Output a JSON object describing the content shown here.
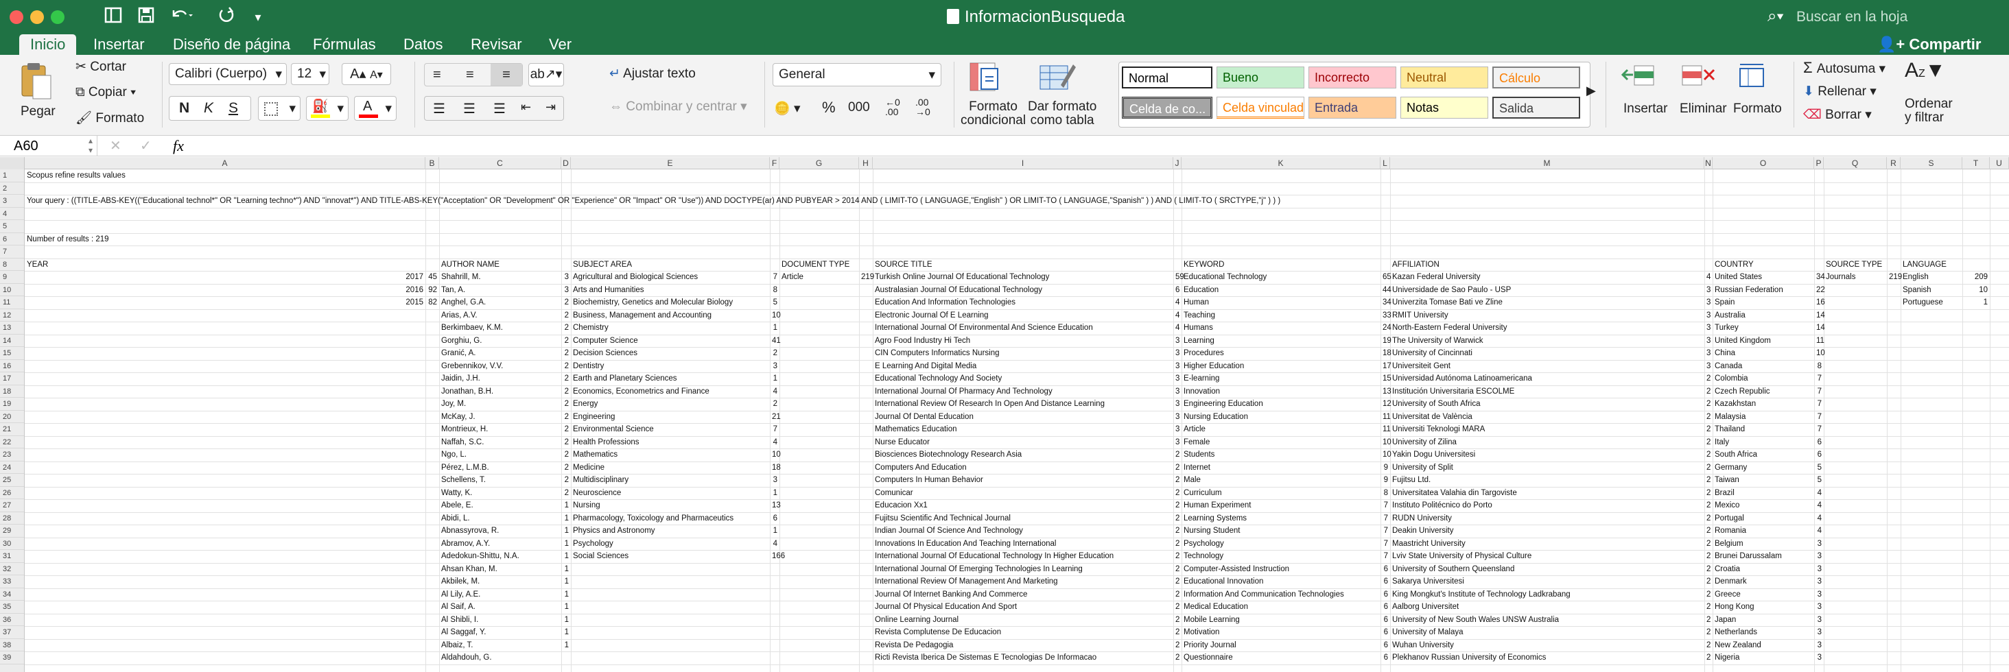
{
  "window": {
    "title": "InformacionBusqueda",
    "search_placeholder": "Buscar en la hoja",
    "share_label": "Compartir",
    "colors": {
      "brand": "#1f7244",
      "ribbon": "#f3f3f3"
    }
  },
  "tabs": [
    "Inicio",
    "Insertar",
    "Diseño de página",
    "Fórmulas",
    "Datos",
    "Revisar",
    "Ver"
  ],
  "active_tab": "Inicio",
  "ribbon": {
    "paste": "Pegar",
    "cut": "Cortar",
    "copy": "Copiar",
    "format_painter": "Formato",
    "font_name": "Calibri (Cuerpo)",
    "font_size": "12",
    "bold": "N",
    "italic": "K",
    "underline": "S",
    "wrap_text": "Ajustar texto",
    "merge_center": "Combinar y centrar",
    "number_format": "General",
    "percent": "%",
    "thousands": "000",
    "conditional_format": [
      "Formato",
      "condicional"
    ],
    "format_as_table": [
      "Dar formato",
      "como tabla"
    ],
    "styles": [
      {
        "label": "Normal",
        "bg": "#ffffff",
        "color": "#000000"
      },
      {
        "label": "Bueno",
        "bg": "#c6efce",
        "color": "#006100"
      },
      {
        "label": "Incorrecto",
        "bg": "#ffc7ce",
        "color": "#9c0006"
      },
      {
        "label": "Neutral",
        "bg": "#ffeb9c",
        "color": "#9c5700"
      },
      {
        "label": "Cálculo",
        "bg": "#f2f2f2",
        "color": "#fa7d00"
      },
      {
        "label": "Celda de co...",
        "bg": "#a5a5a5",
        "color": "#ffffff"
      },
      {
        "label": "Celda vinculada",
        "bg": "#ffffff",
        "color": "#fa7d00"
      },
      {
        "label": "Entrada",
        "bg": "#ffcc99",
        "color": "#3f3f76"
      },
      {
        "label": "Notas",
        "bg": "#ffffcc",
        "color": "#000000"
      },
      {
        "label": "Salida",
        "bg": "#f2f2f2",
        "color": "#3f3f3f"
      }
    ],
    "insert": "Insertar",
    "delete": "Eliminar",
    "format": "Formato",
    "autosum": "Autosuma",
    "fill": "Rellenar",
    "clear": "Borrar",
    "sort_filter": [
      "Ordenar",
      "y filtrar"
    ]
  },
  "formula_bar": {
    "name_box": "A60",
    "fx": "fx",
    "content": ""
  },
  "sheet": {
    "columns": [
      "A",
      "B",
      "C",
      "D",
      "E",
      "F",
      "G",
      "H",
      "I",
      "J",
      "K",
      "L",
      "M",
      "N",
      "O",
      "P",
      "Q",
      "R",
      "S",
      "T",
      "U"
    ],
    "row_numbers": [
      "1",
      "2",
      "3",
      "4",
      "5",
      "6",
      "7",
      "8",
      "9",
      "10",
      "11",
      "12",
      "13",
      "14",
      "15",
      "16",
      "17",
      "18",
      "19",
      "20",
      "21",
      "22",
      "23",
      "24",
      "25",
      "26",
      "27",
      "28",
      "29",
      "30",
      "31",
      "32",
      "33",
      "34",
      "35",
      "36",
      "37",
      "38",
      "39"
    ],
    "a1": "Scopus refine results values",
    "a3": "Your query : ((TITLE-ABS-KEY((\"Educational technol*\" OR \"Learning techno*\") AND \"innovat*\") AND TITLE-ABS-KEY(\"Acceptation\" OR \"Development\" OR \"Experience\" OR \"Impact\" OR \"Use\")) AND DOCTYPE(ar) AND PUBYEAR > 2014 AND ( LIMIT-TO ( LANGUAGE,\"English\" ) OR LIMIT-TO ( LANGUAGE,\"Spanish\" ) )  AND ( LIMIT-TO ( SRCTYPE,\"j\" ) ) )",
    "a6": "Number of results : 219",
    "headers": {
      "year": "YEAR",
      "author": "AUTHOR NAME",
      "subject": "SUBJECT AREA",
      "doctype": "DOCUMENT TYPE",
      "source": "SOURCE TITLE",
      "keyword": "KEYWORD",
      "affiliation": "AFFILIATION",
      "country": "COUNTRY",
      "srctype": "SOURCE TYPE",
      "language": "LANGUAGE"
    },
    "years": [
      [
        "2017",
        "45"
      ],
      [
        "2016",
        "92"
      ],
      [
        "2015",
        "82"
      ]
    ],
    "authors": [
      [
        "Shahrill, M.",
        "3"
      ],
      [
        "Tan, A.",
        "3"
      ],
      [
        "Anghel, G.A.",
        "2"
      ],
      [
        "Arias, A.V.",
        "2"
      ],
      [
        "Berkimbaev, K.M.",
        "2"
      ],
      [
        "Gorghiu, G.",
        "2"
      ],
      [
        "Granić, A.",
        "2"
      ],
      [
        "Grebennikov, V.V.",
        "2"
      ],
      [
        "Jaidin, J.H.",
        "2"
      ],
      [
        "Jonathan, B.H.",
        "2"
      ],
      [
        "Joy, M.",
        "2"
      ],
      [
        "McKay, J.",
        "2"
      ],
      [
        "Montrieux, H.",
        "2"
      ],
      [
        "Naffah, S.C.",
        "2"
      ],
      [
        "Ngo, L.",
        "2"
      ],
      [
        "Pérez, L.M.B.",
        "2"
      ],
      [
        "Schellens, T.",
        "2"
      ],
      [
        "Watty, K.",
        "2"
      ],
      [
        "Abele, E.",
        "1"
      ],
      [
        "Abidi, L.",
        "1"
      ],
      [
        "Abnassyrova, R.",
        "1"
      ],
      [
        "Abramov, A.Y.",
        "1"
      ],
      [
        "Adedokun-Shittu, N.A.",
        "1"
      ],
      [
        "Ahsan Khan, M.",
        "1"
      ],
      [
        "Akbilek, M.",
        "1"
      ],
      [
        "Al Lily, A.E.",
        "1"
      ],
      [
        "Al Saif, A.",
        "1"
      ],
      [
        "Al Shibli, I.",
        "1"
      ],
      [
        "Al Saggaf, Y.",
        "1"
      ],
      [
        "Albaiz, T.",
        "1"
      ],
      [
        "Aldahdouh, G.",
        ""
      ]
    ],
    "subjects": [
      [
        "Agricultural and Biological Sciences",
        "7"
      ],
      [
        "Arts and Humanities",
        "8"
      ],
      [
        "Biochemistry, Genetics and Molecular Biology",
        "5"
      ],
      [
        "Business, Management and Accounting",
        "10"
      ],
      [
        "Chemistry",
        "1"
      ],
      [
        "Computer Science",
        "41"
      ],
      [
        "Decision Sciences",
        "2"
      ],
      [
        "Dentistry",
        "3"
      ],
      [
        "Earth and Planetary Sciences",
        "1"
      ],
      [
        "Economics, Econometrics and Finance",
        "4"
      ],
      [
        "Energy",
        "2"
      ],
      [
        "Engineering",
        "21"
      ],
      [
        "Environmental Science",
        "7"
      ],
      [
        "Health Professions",
        "4"
      ],
      [
        "Mathematics",
        "10"
      ],
      [
        "Medicine",
        "18"
      ],
      [
        "Multidisciplinary",
        "3"
      ],
      [
        "Neuroscience",
        "1"
      ],
      [
        "Nursing",
        "13"
      ],
      [
        "Pharmacology, Toxicology and Pharmaceutics",
        "6"
      ],
      [
        "Physics and Astronomy",
        "1"
      ],
      [
        "Psychology",
        "4"
      ],
      [
        "Social Sciences",
        "166"
      ]
    ],
    "doctypes": [
      [
        "Article",
        "219"
      ]
    ],
    "sources": [
      [
        "Turkish Online Journal Of Educational Technology",
        "59"
      ],
      [
        "Australasian Journal Of Educational Technology",
        "6"
      ],
      [
        "Education And Information Technologies",
        "4"
      ],
      [
        "Electronic Journal Of E Learning",
        "4"
      ],
      [
        "International Journal Of Environmental And Science Education",
        "4"
      ],
      [
        "Agro Food Industry Hi Tech",
        "3"
      ],
      [
        "CIN Computers Informatics Nursing",
        "3"
      ],
      [
        "E Learning And Digital Media",
        "3"
      ],
      [
        "Educational Technology And Society",
        "3"
      ],
      [
        "International Journal Of Pharmacy And Technology",
        "3"
      ],
      [
        "International Review Of Research In Open And Distance Learning",
        "3"
      ],
      [
        "Journal Of Dental Education",
        "3"
      ],
      [
        "Mathematics Education",
        "3"
      ],
      [
        "Nurse Educator",
        "3"
      ],
      [
        "Biosciences Biotechnology Research Asia",
        "2"
      ],
      [
        "Computers And Education",
        "2"
      ],
      [
        "Computers In Human Behavior",
        "2"
      ],
      [
        "Comunicar",
        "2"
      ],
      [
        "Educacion Xx1",
        "2"
      ],
      [
        "Fujitsu Scientific And Technical Journal",
        "2"
      ],
      [
        "Indian Journal Of Science And Technology",
        "2"
      ],
      [
        "Innovations In Education And Teaching International",
        "2"
      ],
      [
        "International Journal Of Educational Technology In Higher Education",
        "2"
      ],
      [
        "International Journal Of Emerging Technologies In Learning",
        "2"
      ],
      [
        "International Review Of Management And Marketing",
        "2"
      ],
      [
        "Journal Of Internet Banking And Commerce",
        "2"
      ],
      [
        "Journal Of Physical Education And Sport",
        "2"
      ],
      [
        "Online Learning Journal",
        "2"
      ],
      [
        "Revista Complutense De Educacion",
        "2"
      ],
      [
        "Revista De Pedagogia",
        "2"
      ],
      [
        "Ricti Revista Iberica De Sistemas E Tecnologias De Informacao",
        "2"
      ]
    ],
    "keywords": [
      [
        "Educational Technology",
        "65"
      ],
      [
        "Education",
        "44"
      ],
      [
        "Human",
        "34"
      ],
      [
        "Teaching",
        "33"
      ],
      [
        "Humans",
        "24"
      ],
      [
        "Learning",
        "19"
      ],
      [
        "Procedures",
        "18"
      ],
      [
        "Higher Education",
        "17"
      ],
      [
        "E-learning",
        "15"
      ],
      [
        "Innovation",
        "13"
      ],
      [
        "Engineering Education",
        "12"
      ],
      [
        "Nursing Education",
        "11"
      ],
      [
        "Article",
        "11"
      ],
      [
        "Female",
        "10"
      ],
      [
        "Students",
        "10"
      ],
      [
        "Internet",
        "9"
      ],
      [
        "Male",
        "9"
      ],
      [
        "Curriculum",
        "8"
      ],
      [
        "Human Experiment",
        "7"
      ],
      [
        "Learning Systems",
        "7"
      ],
      [
        "Nursing Student",
        "7"
      ],
      [
        "Psychology",
        "7"
      ],
      [
        "Technology",
        "7"
      ],
      [
        "Computer-Assisted Instruction",
        "6"
      ],
      [
        "Educational Innovation",
        "6"
      ],
      [
        "Information And Communication Technologies",
        "6"
      ],
      [
        "Medical Education",
        "6"
      ],
      [
        "Mobile Learning",
        "6"
      ],
      [
        "Motivation",
        "6"
      ],
      [
        "Priority Journal",
        "6"
      ],
      [
        "Questionnaire",
        "6"
      ]
    ],
    "affiliations": [
      [
        "Kazan Federal University",
        "4"
      ],
      [
        "Universidade de Sao Paulo - USP",
        "3"
      ],
      [
        "Univerzita Tomase Bati ve Zline",
        "3"
      ],
      [
        "RMIT University",
        "3"
      ],
      [
        "North-Eastern Federal University",
        "3"
      ],
      [
        "The University of Warwick",
        "3"
      ],
      [
        "University of Cincinnati",
        "3"
      ],
      [
        "Universiteit Gent",
        "3"
      ],
      [
        "Universidad Autónoma Latinoamericana",
        "2"
      ],
      [
        "Institución Universitaria ESCOLME",
        "2"
      ],
      [
        "University of South Africa",
        "2"
      ],
      [
        "Universitat de València",
        "2"
      ],
      [
        "Universiti Teknologi MARA",
        "2"
      ],
      [
        "University of Zilina",
        "2"
      ],
      [
        "Yakin Dogu Universitesi",
        "2"
      ],
      [
        "University of Split",
        "2"
      ],
      [
        "Fujitsu Ltd.",
        "2"
      ],
      [
        "Universitatea Valahia din Targoviste",
        "2"
      ],
      [
        "Instituto Politécnico do Porto",
        "2"
      ],
      [
        "RUDN University",
        "2"
      ],
      [
        "Deakin University",
        "2"
      ],
      [
        "Maastricht University",
        "2"
      ],
      [
        "Lviv State University of Physical Culture",
        "2"
      ],
      [
        "University of Southern Queensland",
        "2"
      ],
      [
        "Sakarya Universitesi",
        "2"
      ],
      [
        "King Mongkut's Institute of Technology Ladkrabang",
        "2"
      ],
      [
        "Aalborg Universitet",
        "2"
      ],
      [
        "University of New South Wales UNSW Australia",
        "2"
      ],
      [
        "University of Malaya",
        "2"
      ],
      [
        "Wuhan University",
        "2"
      ],
      [
        "Plekhanov Russian University of Economics",
        "2"
      ]
    ],
    "countries": [
      [
        "United States",
        "34"
      ],
      [
        "Russian Federation",
        "22"
      ],
      [
        "Spain",
        "16"
      ],
      [
        "Australia",
        "14"
      ],
      [
        "Turkey",
        "14"
      ],
      [
        "United Kingdom",
        "11"
      ],
      [
        "China",
        "10"
      ],
      [
        "Canada",
        "8"
      ],
      [
        "Colombia",
        "7"
      ],
      [
        "Czech Republic",
        "7"
      ],
      [
        "Kazakhstan",
        "7"
      ],
      [
        "Malaysia",
        "7"
      ],
      [
        "Thailand",
        "7"
      ],
      [
        "Italy",
        "6"
      ],
      [
        "South Africa",
        "6"
      ],
      [
        "Germany",
        "5"
      ],
      [
        "Taiwan",
        "5"
      ],
      [
        "Brazil",
        "4"
      ],
      [
        "Mexico",
        "4"
      ],
      [
        "Portugal",
        "4"
      ],
      [
        "Romania",
        "4"
      ],
      [
        "Belgium",
        "3"
      ],
      [
        "Brunei Darussalam",
        "3"
      ],
      [
        "Croatia",
        "3"
      ],
      [
        "Denmark",
        "3"
      ],
      [
        "Greece",
        "3"
      ],
      [
        "Hong Kong",
        "3"
      ],
      [
        "Japan",
        "3"
      ],
      [
        "Netherlands",
        "3"
      ],
      [
        "New Zealand",
        "3"
      ],
      [
        "Nigeria",
        "3"
      ]
    ],
    "srctypes": [
      [
        "Journals",
        "219"
      ]
    ],
    "languages": [
      [
        "English",
        "209"
      ],
      [
        "Spanish",
        "10"
      ],
      [
        "Portuguese",
        "1"
      ]
    ]
  }
}
